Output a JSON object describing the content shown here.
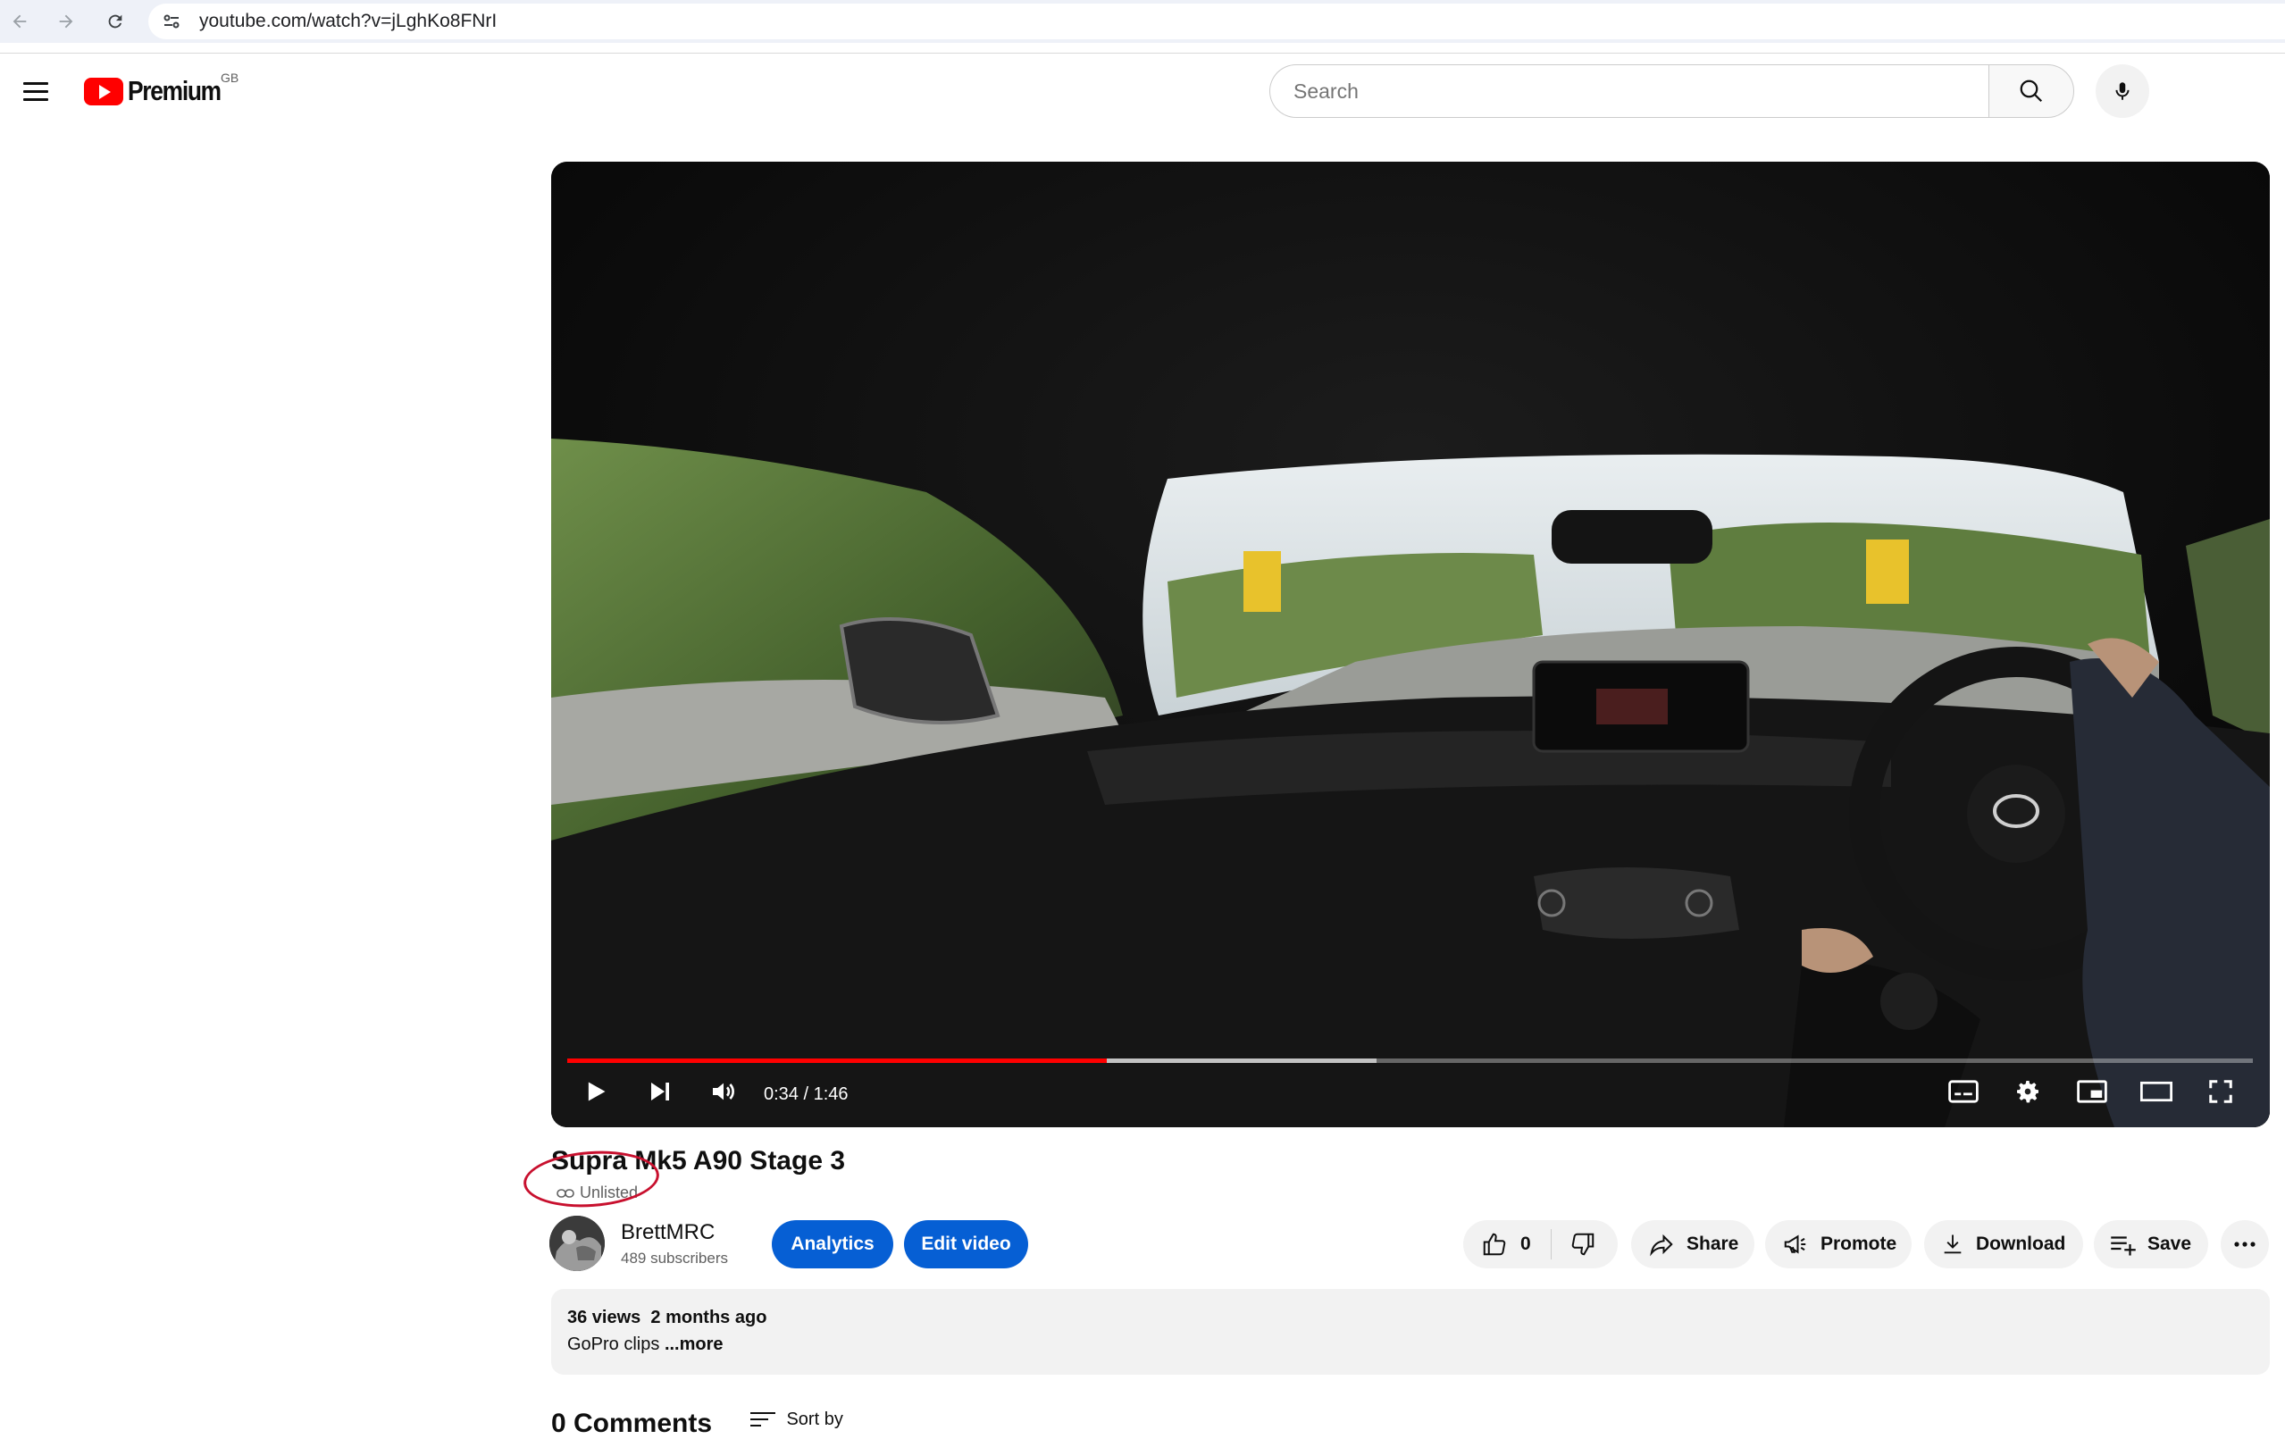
{
  "browser": {
    "url": "youtube.com/watch?v=jLghKo8FNrI"
  },
  "header": {
    "logo_text": "Premium",
    "country_code": "GB",
    "search_placeholder": "Search"
  },
  "player": {
    "time": "0:34 / 1:46",
    "played_fraction": 0.32,
    "buffered_fraction": 0.48
  },
  "video": {
    "title": "Supra Mk5 A90 Stage 3",
    "visibility": "Unlisted",
    "channel": "BrettMRC",
    "subscribers": "489 subscribers"
  },
  "actions": {
    "analytics": "Analytics",
    "edit": "Edit video",
    "likes": "0",
    "share": "Share",
    "promote": "Promote",
    "download": "Download",
    "save": "Save"
  },
  "description": {
    "meta": "36 views  2 months ago",
    "text": "GoPro clips ",
    "more": "...more"
  },
  "comments": {
    "heading": "0 Comments",
    "sort": "Sort by"
  },
  "colors": {
    "brand_red": "#ff0000",
    "accent_blue": "#065fd4",
    "annotation_red": "#c8102e"
  }
}
